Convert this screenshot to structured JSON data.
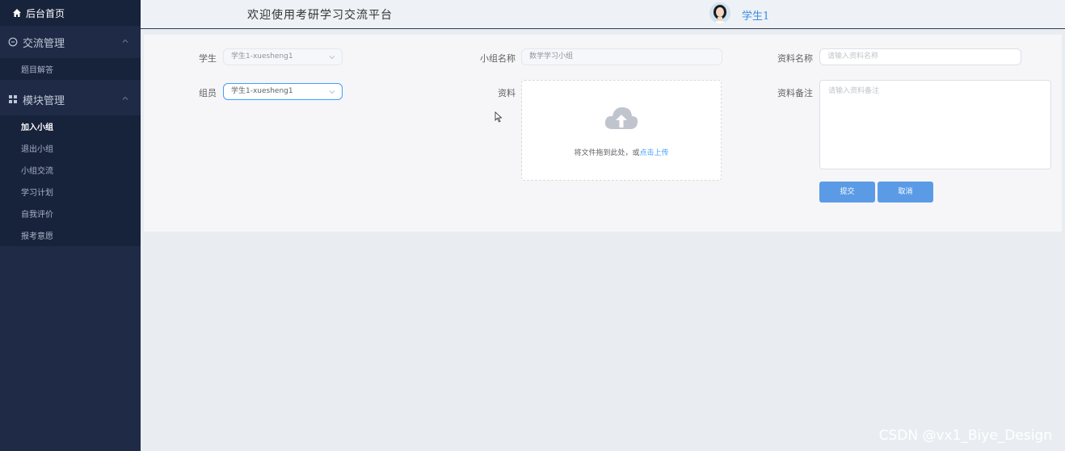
{
  "sidebar": {
    "home_label": "后台首页",
    "groups": [
      {
        "label": "交流管理",
        "icon": "chat-icon",
        "items": [
          "题目解答"
        ]
      },
      {
        "label": "模块管理",
        "icon": "grid-icon",
        "items": [
          "加入小组",
          "退出小组",
          "小组交流",
          "学习计划",
          "自我评价",
          "报考意愿"
        ]
      }
    ],
    "active_item": "加入小组"
  },
  "header": {
    "welcome": "欢迎使用考研学习交流平台",
    "username": "学生1"
  },
  "form": {
    "student_label": "学生",
    "student_value": "学生1-xuesheng1",
    "group_name_label": "小组名称",
    "group_name_value": "数学学习小组",
    "material_name_label": "资料名称",
    "material_name_placeholder": "请输入资料名称",
    "member_label": "组员",
    "member_value": "学生1-xuesheng1",
    "material_label": "资料",
    "upload_text": "将文件拖到此处，或",
    "upload_link": "点击上传",
    "note_label": "资料备注",
    "note_placeholder": "请输入资料备注",
    "submit_label": "提交",
    "cancel_label": "取消"
  },
  "watermark": "CSDN @vx1_Biye_Design",
  "colors": {
    "sidebar_bg": "#1f2b46",
    "accent": "#409eff",
    "button": "#5b9be6"
  }
}
